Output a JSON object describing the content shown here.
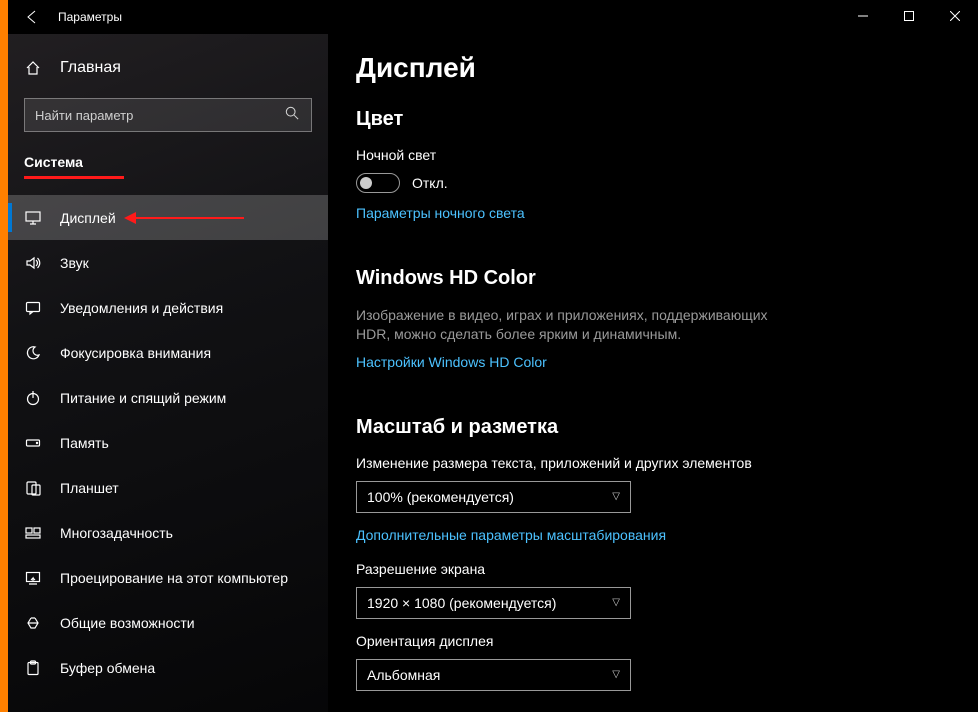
{
  "window": {
    "title": "Параметры"
  },
  "sidebar": {
    "home": "Главная",
    "search_placeholder": "Найти параметр",
    "group": "Система",
    "items": [
      {
        "id": "display",
        "label": "Дисплей",
        "icon": "monitor-icon",
        "selected": true
      },
      {
        "id": "sound",
        "label": "Звук",
        "icon": "speaker-icon",
        "selected": false
      },
      {
        "id": "notifications",
        "label": "Уведомления и действия",
        "icon": "chat-icon",
        "selected": false
      },
      {
        "id": "focus",
        "label": "Фокусировка внимания",
        "icon": "moon-icon",
        "selected": false
      },
      {
        "id": "power",
        "label": "Питание и спящий режим",
        "icon": "power-icon",
        "selected": false
      },
      {
        "id": "storage",
        "label": "Память",
        "icon": "storage-icon",
        "selected": false
      },
      {
        "id": "tablet",
        "label": "Планшет",
        "icon": "tablet-icon",
        "selected": false
      },
      {
        "id": "multitask",
        "label": "Многозадачность",
        "icon": "multitask-icon",
        "selected": false
      },
      {
        "id": "projecting",
        "label": "Проецирование на этот компьютер",
        "icon": "project-icon",
        "selected": false
      },
      {
        "id": "shared",
        "label": "Общие возможности",
        "icon": "share-icon",
        "selected": false
      },
      {
        "id": "clipboard",
        "label": "Буфер обмена",
        "icon": "clipboard-icon",
        "selected": false
      }
    ]
  },
  "main": {
    "title": "Дисплей",
    "color": {
      "heading": "Цвет",
      "night_light_label": "Ночной свет",
      "night_light_state": "Откл.",
      "night_light_link": "Параметры ночного света"
    },
    "hd": {
      "heading": "Windows HD Color",
      "description": "Изображение в видео, играх и приложениях, поддерживающих HDR, можно сделать более ярким и динамичным.",
      "link": "Настройки Windows HD Color"
    },
    "scale": {
      "heading": "Масштаб и разметка",
      "size_label": "Изменение размера текста, приложений и других элементов",
      "size_value": "100% (рекомендуется)",
      "advanced_link": "Дополнительные параметры масштабирования",
      "resolution_label": "Разрешение экрана",
      "resolution_value": "1920 × 1080 (рекомендуется)",
      "orientation_label": "Ориентация дисплея",
      "orientation_value": "Альбомная"
    }
  }
}
